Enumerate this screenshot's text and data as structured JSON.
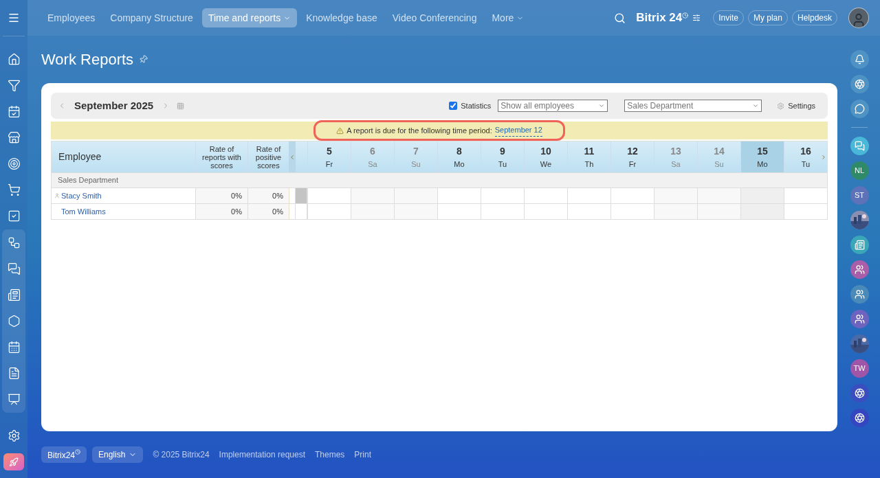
{
  "top_nav": [
    {
      "label": "Employees",
      "selected": false,
      "dropdown": false
    },
    {
      "label": "Company Structure",
      "selected": false,
      "dropdown": false
    },
    {
      "label": "Time and reports",
      "selected": true,
      "dropdown": true
    },
    {
      "label": "Knowledge base",
      "selected": false,
      "dropdown": false
    },
    {
      "label": "Video Conferencing",
      "selected": false,
      "dropdown": false
    },
    {
      "label": "More",
      "selected": false,
      "dropdown": true
    }
  ],
  "header": {
    "logo": "Bitrix 24",
    "buttons": [
      "Invite",
      "My plan",
      "Helpdesk"
    ]
  },
  "page_title": "Work Reports",
  "toolbar": {
    "month": "September 2025",
    "statistics": {
      "label": "Statistics",
      "checked": true
    },
    "employee_filter": "Show all employees",
    "department_filter": "Sales Department",
    "settings": "Settings"
  },
  "alert": {
    "text": "A report is due for the following time period:",
    "link": "September 12"
  },
  "table": {
    "columns": [
      "Employee",
      "Rate of reports with scores",
      "Rate of positive scores"
    ],
    "days": [
      {
        "day": "5",
        "weekday": "Fr",
        "weekend": false,
        "selected": false
      },
      {
        "day": "6",
        "weekday": "Sa",
        "weekend": true,
        "selected": false
      },
      {
        "day": "7",
        "weekday": "Su",
        "weekend": true,
        "selected": false
      },
      {
        "day": "8",
        "weekday": "Mo",
        "weekend": false,
        "selected": false
      },
      {
        "day": "9",
        "weekday": "Tu",
        "weekend": false,
        "selected": false
      },
      {
        "day": "10",
        "weekday": "We",
        "weekend": false,
        "selected": false
      },
      {
        "day": "11",
        "weekday": "Th",
        "weekend": false,
        "selected": false
      },
      {
        "day": "12",
        "weekday": "Fr",
        "weekend": false,
        "selected": false
      },
      {
        "day": "13",
        "weekday": "Sa",
        "weekend": true,
        "selected": false
      },
      {
        "day": "14",
        "weekday": "Su",
        "weekend": true,
        "selected": false
      },
      {
        "day": "15",
        "weekday": "Mo",
        "weekend": false,
        "selected": true
      },
      {
        "day": "16",
        "weekday": "Tu",
        "weekend": false,
        "selected": false
      }
    ],
    "group": "Sales Department",
    "rows": [
      {
        "name": "Stacy Smith",
        "rate_scores": "0%",
        "rate_positive": "0%",
        "current_user": true
      },
      {
        "name": "Tom Williams",
        "rate_scores": "0%",
        "rate_positive": "0%",
        "current_user": false
      }
    ]
  },
  "right_rail": [
    {
      "kind": "bell",
      "color": "#4f93c4"
    },
    {
      "kind": "logo",
      "color": "#4f93c4"
    },
    {
      "kind": "chat",
      "color": "#4f93c4"
    },
    {
      "kind": "divider"
    },
    {
      "kind": "messages",
      "color": "#49b8d8"
    },
    {
      "kind": "initials",
      "label": "NL",
      "color": "#2f8a6a"
    },
    {
      "kind": "initials",
      "label": "ST",
      "color": "#5d72b8"
    },
    {
      "kind": "picture",
      "color": "#8a8fb0"
    },
    {
      "kind": "news",
      "color": "#3aa6b8"
    },
    {
      "kind": "group",
      "color": "#a85ea8"
    },
    {
      "kind": "group",
      "color": "#4a8ab8"
    },
    {
      "kind": "group",
      "color": "#6e64c0"
    },
    {
      "kind": "picture",
      "color": "#4a6aa8"
    },
    {
      "kind": "initials",
      "label": "TW",
      "color": "#a056a8"
    },
    {
      "kind": "logo",
      "color": "#3b4ec0"
    },
    {
      "kind": "logo",
      "color": "#3546c0"
    }
  ],
  "footer": {
    "brand": "Bitrix24",
    "language": "English",
    "copyright": "© 2025 Bitrix24",
    "links": [
      "Implementation request",
      "Themes",
      "Print"
    ]
  }
}
